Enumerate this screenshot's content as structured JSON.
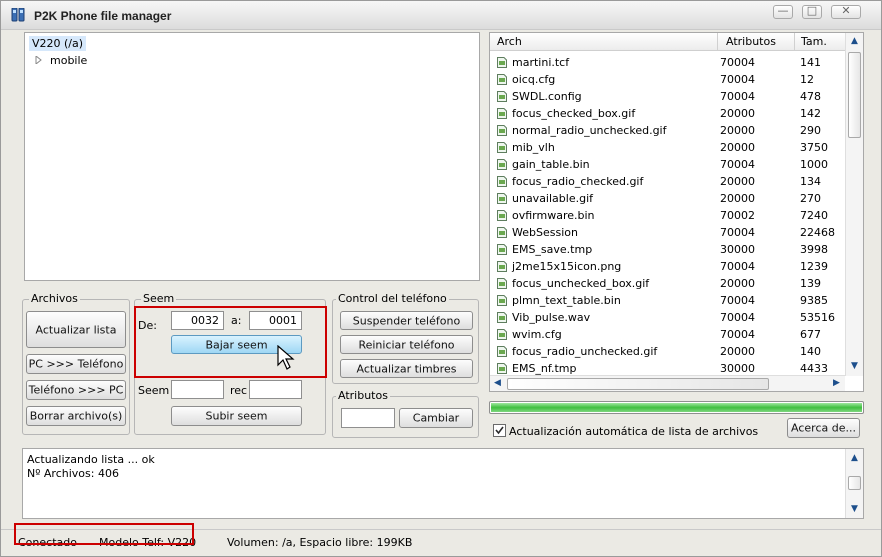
{
  "window": {
    "title": "P2K Phone file manager"
  },
  "window_controls": {
    "minimize": "—",
    "maximize": "□",
    "close": "✕"
  },
  "tree": {
    "root": "V220 (/a)",
    "children": [
      "mobile"
    ]
  },
  "archivos": {
    "legend": "Archivos",
    "actualizar": "Actualizar lista",
    "pc_to_phone": "PC >>> Teléfono",
    "phone_to_pc": "Teléfono >>> PC",
    "borrar": "Borrar archivo(s)"
  },
  "seem": {
    "legend": "Seem",
    "de_label": "De:",
    "de_value": "0032",
    "a_label": "a:",
    "a_value": "0001",
    "bajar": "Bajar seem",
    "seem_label": "Seem",
    "seem_value": "",
    "rec_label": "rec",
    "rec_value": "",
    "subir": "Subir seem"
  },
  "control": {
    "legend": "Control del teléfono",
    "suspender": "Suspender teléfono",
    "reiniciar": "Reiniciar teléfono",
    "timbres": "Actualizar timbres"
  },
  "atributos": {
    "legend": "Atributos",
    "value": "",
    "cambiar": "Cambiar"
  },
  "files": {
    "columns": [
      "Arch",
      "Atributos",
      "Tam."
    ],
    "rows": [
      [
        "martini.tcf",
        "70004",
        "141"
      ],
      [
        "oicq.cfg",
        "70004",
        "12"
      ],
      [
        "SWDL.config",
        "70004",
        "478"
      ],
      [
        "focus_checked_box.gif",
        "20000",
        "142"
      ],
      [
        "normal_radio_unchecked.gif",
        "20000",
        "290"
      ],
      [
        "mib_vlh",
        "20000",
        "3750"
      ],
      [
        "gain_table.bin",
        "70004",
        "1000"
      ],
      [
        "focus_radio_checked.gif",
        "20000",
        "134"
      ],
      [
        "unavailable.gif",
        "20000",
        "270"
      ],
      [
        "ovfirmware.bin",
        "70002",
        "7240"
      ],
      [
        "WebSession",
        "70004",
        "22468"
      ],
      [
        "EMS_save.tmp",
        "30000",
        "3998"
      ],
      [
        "j2me15x15icon.png",
        "70004",
        "1239"
      ],
      [
        "focus_unchecked_box.gif",
        "20000",
        "139"
      ],
      [
        "plmn_text_table.bin",
        "70004",
        "9385"
      ],
      [
        "Vib_pulse.wav",
        "70004",
        "53516"
      ],
      [
        "wvim.cfg",
        "70004",
        "677"
      ],
      [
        "focus_radio_unchecked.gif",
        "20000",
        "140"
      ],
      [
        "EMS_nf.tmp",
        "30000",
        "4433"
      ]
    ]
  },
  "progress": {
    "fraction": 1.0
  },
  "auto_update": {
    "label": "Actualización automática de lista de archivos",
    "checked": true
  },
  "acerca": "Acerca de...",
  "log": [
    "Actualizando lista ... ok",
    "Nº Archivos: 406"
  ],
  "status": {
    "connection": "Conectado",
    "model": "Modelo Telf: V220",
    "volume": "Volumen: /a, Espacio libre: 199KB"
  },
  "colors": {
    "highlight": "#cc0000",
    "progress": "#3fbf3f",
    "tree_selected": "#d6e8fb"
  }
}
